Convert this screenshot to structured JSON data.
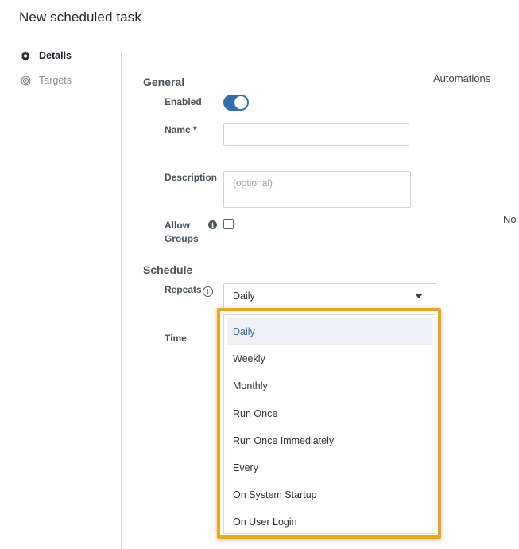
{
  "page": {
    "title": "New scheduled task"
  },
  "sidebar": {
    "items": [
      {
        "label": "Details",
        "icon": "gear-icon",
        "active": true
      },
      {
        "label": "Targets",
        "icon": "target-icon",
        "active": false
      }
    ]
  },
  "general": {
    "title": "General",
    "enabled_label": "Enabled",
    "enabled_value": true,
    "name_label": "Name *",
    "name_value": "",
    "description_label": "Description",
    "description_placeholder": "(optional)",
    "allow_groups_label_line1": "Allow",
    "allow_groups_label_line2": "Groups",
    "allow_groups_checked": false
  },
  "automations": {
    "label": "Automations",
    "value": "No"
  },
  "schedule": {
    "title": "Schedule",
    "repeats_label": "Repeats",
    "repeats_value": "Daily",
    "time_label": "Time",
    "options": [
      "Daily",
      "Weekly",
      "Monthly",
      "Run Once",
      "Run Once Immediately",
      "Every",
      "On System Startup",
      "On User Login"
    ],
    "selected_option": "Daily"
  },
  "colors": {
    "accent": "#2f6fae",
    "highlight": "#f2a51a"
  }
}
